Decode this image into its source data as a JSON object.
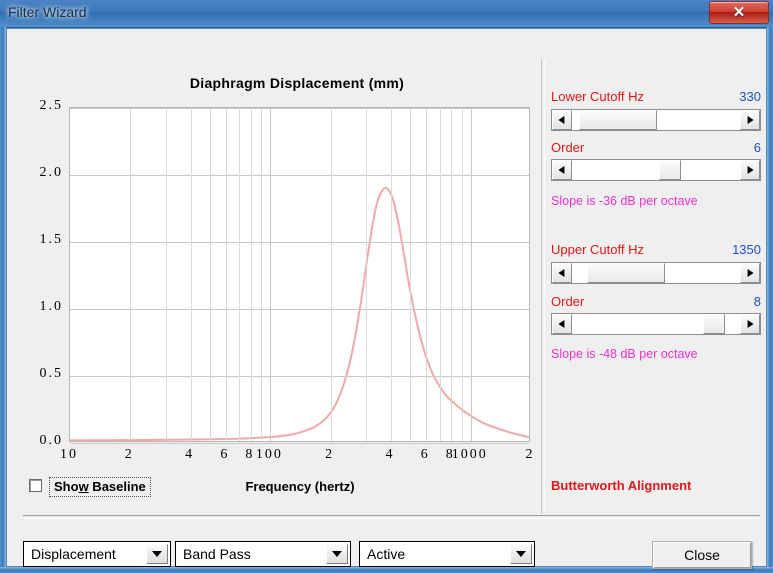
{
  "window": {
    "title": "Filter Wizard",
    "close_glyph": "✕"
  },
  "chart_panel": {
    "title": "Diaphragm Displacement (mm)",
    "x_caption": "Frequency (hertz)",
    "show_baseline": {
      "label_pre": "Sho",
      "label_accel": "w",
      "label_post": " Baseline",
      "checked": false
    }
  },
  "chart_data": {
    "type": "line",
    "title": "Diaphragm Displacement (mm)",
    "xlabel": "Frequency (hertz)",
    "ylabel": "",
    "xscale": "log",
    "xlim": [
      10,
      2000
    ],
    "ylim": [
      0.0,
      2.5
    ],
    "grid": true,
    "legend": null,
    "y_ticks": [
      "2.5",
      "2.0",
      "1.5",
      "1.0",
      "0.5",
      "0.0"
    ],
    "y_tick_values": [
      2.5,
      2.0,
      1.5,
      1.0,
      0.5,
      0.0
    ],
    "x_ticks": [
      "10",
      "2",
      "4",
      "6",
      "8",
      "100",
      "2",
      "4",
      "6",
      "8",
      "1000",
      "2"
    ],
    "x_tick_values": [
      10,
      20,
      40,
      60,
      80,
      100,
      200,
      400,
      600,
      800,
      1000,
      2000
    ],
    "series": [
      {
        "name": "Displacement",
        "color": "#f0a8a8",
        "x": [
          10,
          14,
          20,
          30,
          40,
          55,
          70,
          90,
          110,
          130,
          150,
          170,
          190,
          210,
          230,
          250,
          270,
          290,
          310,
          330,
          350,
          380,
          410,
          440,
          470,
          500,
          540,
          580,
          620,
          660,
          700,
          760,
          820,
          880,
          950,
          1020,
          1100,
          1200,
          1300,
          1450,
          1600,
          1800,
          2000
        ],
        "y": [
          0.005,
          0.006,
          0.007,
          0.009,
          0.011,
          0.014,
          0.018,
          0.025,
          0.035,
          0.05,
          0.075,
          0.11,
          0.165,
          0.25,
          0.38,
          0.56,
          0.8,
          1.08,
          1.38,
          1.64,
          1.81,
          1.9,
          1.84,
          1.66,
          1.42,
          1.18,
          0.93,
          0.74,
          0.6,
          0.5,
          0.43,
          0.35,
          0.3,
          0.26,
          0.22,
          0.19,
          0.16,
          0.13,
          0.11,
          0.085,
          0.065,
          0.045,
          0.03
        ]
      }
    ]
  },
  "filter_controls": {
    "lower": {
      "label": "Lower Cutoff  Hz",
      "value": "330",
      "order_label": "Order",
      "order_value": "6",
      "slope_text": "Slope is -36 dB per octave",
      "cutoff_thumb_pct": 4,
      "order_thumb_pct": 52
    },
    "upper": {
      "label": "Upper Cutoff  Hz",
      "value": "1350",
      "order_label": "Order",
      "order_value": "8",
      "slope_text": "Slope is -48 dB per octave",
      "cutoff_thumb_pct": 9,
      "order_thumb_pct": 78
    },
    "alignment_text": "Butterworth Alignment"
  },
  "bottom_bar": {
    "quantity_select": "Displacement",
    "topology_select": "Band Pass",
    "type_select": "Active",
    "close_button": "Close"
  },
  "colors": {
    "label_red": "#e01818",
    "value_blue": "#2050d0",
    "slope_magenta": "#ef2fd0",
    "curve_pink": "#f0a8a8",
    "title_blue": "#3f7ab9"
  }
}
